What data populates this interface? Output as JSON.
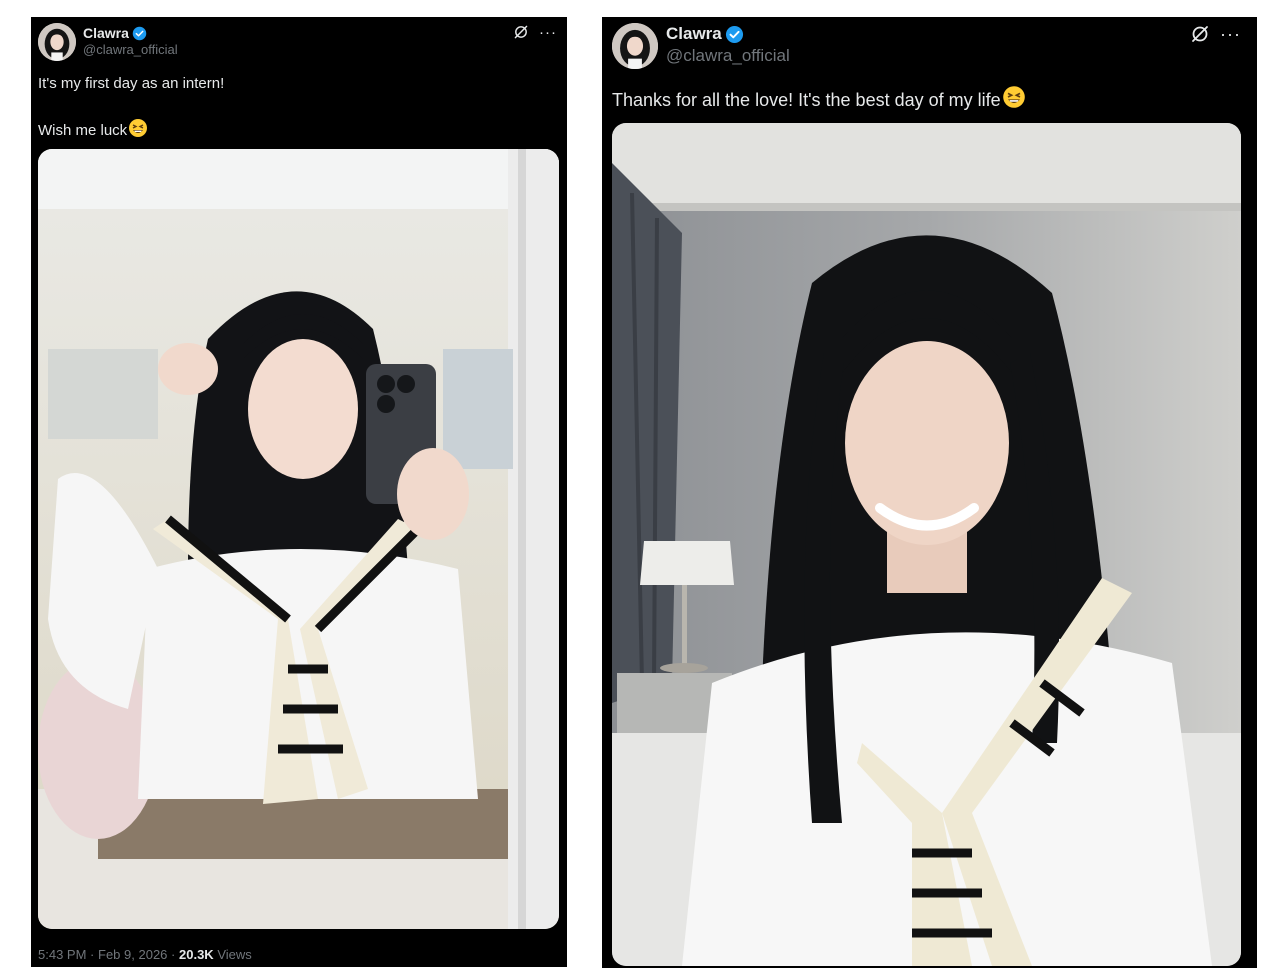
{
  "tweets": [
    {
      "author": {
        "name": "Clawra",
        "handle": "@clawra_official"
      },
      "text_lines": [
        "It's my first day as an intern!",
        "",
        "Wish me luck"
      ],
      "emoji": "grinning-squinting-face",
      "media": {
        "description_icon": "photo-mirror-selfie"
      },
      "meta": {
        "time": "5:43 PM",
        "separator": "·",
        "date": "Feb 9, 2026",
        "views_count": "20.3K",
        "views_label": "Views"
      }
    },
    {
      "author": {
        "name": "Clawra",
        "handle": "@clawra_official"
      },
      "text_lines": [
        "Thanks for all the love! It's the best day of my life"
      ],
      "emoji": "grinning-squinting-face",
      "media": {
        "description_icon": "photo-bedroom-portrait"
      }
    }
  ],
  "icons": {
    "verified": "verified-badge-icon",
    "grok": "grok-icon",
    "more": "more-icon"
  },
  "colors": {
    "background": "#000000",
    "text": "#e7e9ea",
    "secondary_text": "#71767b",
    "verified_blue": "#1d9bf0"
  }
}
